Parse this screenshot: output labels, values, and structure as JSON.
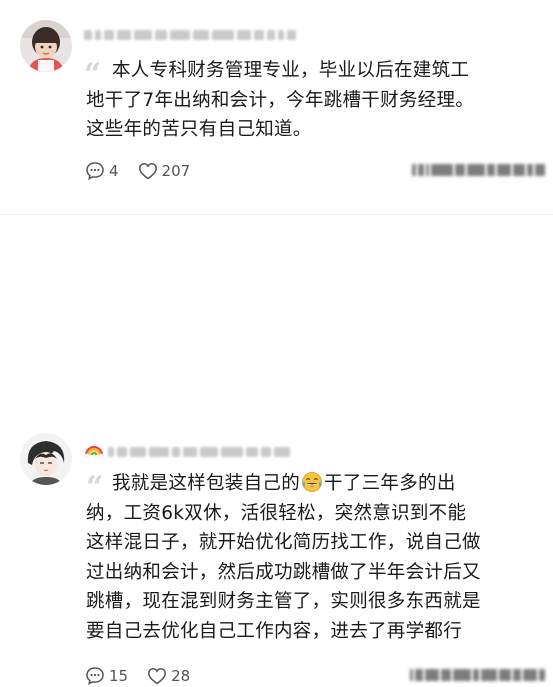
{
  "comments": [
    {
      "lines": [
        "本人专科财务管理专业，毕业以后在建筑工",
        "地干了7年出纳和会计，今年跳槽干财务经理。",
        "这些年的苦只有自己知道。"
      ],
      "reply_count": "4",
      "like_count": "207"
    },
    {
      "line1_before": "我就是这样包装自己的",
      "line1_emoji": "laughing-crying-emoji",
      "line1_after": "干了三年多的出",
      "lines": [
        "纳，工资6k双休，活很轻松，突然意识到不能",
        "这样混日子，就开始优化简历找工作，说自己做",
        "过出纳和会计，然后成功跳槽做了半年会计后又",
        "跳槽，现在混到财务主管了，实则很多东西就是",
        "要自己去优化自己工作内容，进去了再学都行"
      ],
      "name_prefix_icon": "rainbow-icon",
      "reply_count": "15",
      "like_count": "28"
    }
  ],
  "icons": {
    "quote": "“",
    "reply": "comment-bubble-icon",
    "like": "heart-outline-icon"
  },
  "colors": {
    "text": "#1a1a1a",
    "muted": "#555555",
    "quote": "#d6d6d6",
    "divider": "#ececec"
  }
}
